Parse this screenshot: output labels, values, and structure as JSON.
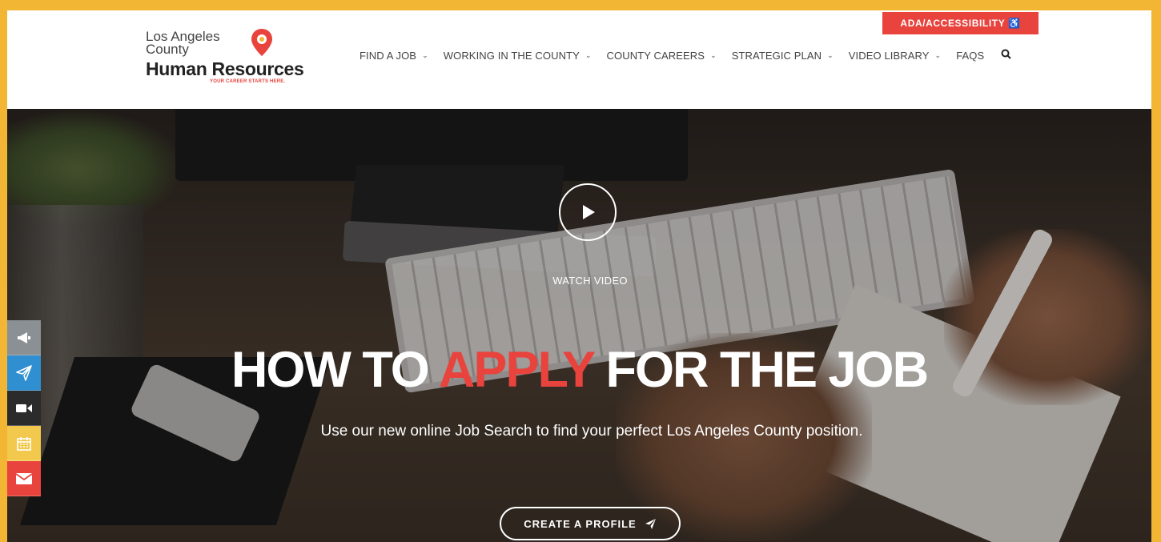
{
  "logo": {
    "line1": "Los Angeles",
    "line2": "County",
    "line3": "Human Resources",
    "tagline": "YOUR CAREER STARTS HERE.",
    "pin_color": "#e8433d"
  },
  "accessibility_button": {
    "label": "ADA/ACCESSIBILITY ♿",
    "color": "#e8433d"
  },
  "nav": {
    "items": [
      {
        "label": "FIND A JOB",
        "has_dropdown": true
      },
      {
        "label": "WORKING IN THE COUNTY",
        "has_dropdown": true
      },
      {
        "label": "COUNTY CAREERS",
        "has_dropdown": true
      },
      {
        "label": "STRATEGIC PLAN",
        "has_dropdown": true
      },
      {
        "label": "VIDEO LIBRARY",
        "has_dropdown": true
      },
      {
        "label": "FAQS",
        "has_dropdown": false
      }
    ],
    "search_icon": "search-icon"
  },
  "hero": {
    "watch_video_label": "WATCH VIDEO",
    "headline_part1": "HOW TO ",
    "headline_accent": "APPLY",
    "headline_part2": " FOR THE JOB",
    "subheadline": "Use our new online Job Search to find your perfect Los Angeles County position.",
    "cta_label": "CREATE A PROFILE",
    "accent_color": "#e8433d"
  },
  "side_toolbar": [
    {
      "icon": "megaphone-icon",
      "color": "#8a9094"
    },
    {
      "icon": "paper-plane-icon",
      "color": "#2f8fd1"
    },
    {
      "icon": "video-camera-icon",
      "color": "#2b2b2b"
    },
    {
      "icon": "calendar-icon",
      "color": "#f2c94c"
    },
    {
      "icon": "envelope-icon",
      "color": "#e8433d"
    }
  ],
  "frame_color": "#f2b534"
}
